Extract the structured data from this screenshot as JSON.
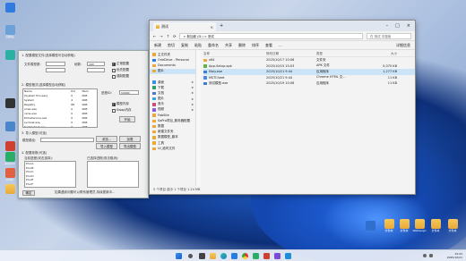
{
  "desktop": {
    "left_icons": [
      {
        "label": "",
        "color": "#2f7be0"
      },
      {
        "label": "回收站",
        "color": "#6aa1d8"
      },
      {
        "label": "",
        "color": "#2ab1a1"
      },
      {
        "label": "",
        "color": "#333333"
      },
      {
        "label": "",
        "color": "#4a86c9"
      },
      {
        "label": "",
        "color": "#d04030"
      },
      {
        "label": "WeChat",
        "color": "#2aae67"
      },
      {
        "label": "Video",
        "color": "#e06040"
      },
      {
        "label": "",
        "color": "#ffb020"
      }
    ],
    "right_icons": [
      {
        "label": ""
      },
      {
        "label": "文件夹"
      },
      {
        "label": "文件夹"
      },
      {
        "label": "WeDesign"
      },
      {
        "label": "文件夹"
      },
      {
        "label": "文件夹"
      }
    ]
  },
  "tool": {
    "sec1": "1. 配置模型文件(选择模型可自动获取)",
    "size_label": "文件模型数:",
    "size_value": "",
    "num_label": "帧数:",
    "num_value": "100",
    "chk1": "正常配置",
    "chk2": "优先配置",
    "chk3": "强制配置",
    "sec2": "2. 模型格式(选择模型自动获取)",
    "table_headers": [
      "Name",
      "Pid",
      "Mem"
    ],
    "table_rows": [
      [
        "[System Process]",
        "0",
        "0KB"
      ],
      [
        "System",
        "4",
        "0KB"
      ],
      [
        "Registry",
        "88",
        "0KB"
      ],
      [
        "smss.exe",
        "0",
        "0KB"
      ],
      [
        "csrss.exe",
        "0",
        "0KB"
      ],
      [
        "ExtraService.exe",
        "0",
        "0KB"
      ],
      [
        "svchost.exe",
        "0",
        "0KB"
      ],
      [
        "fontdrvhost.exe",
        "0",
        "0KB"
      ]
    ],
    "sec2_input_label": "进程ID:",
    "sec2_input_value": "10000",
    "radio1": "模型内存",
    "radio2": "Swap内存",
    "start_btn": "开始",
    "sec3": "3. 导入模型(可选)",
    "model_path_label": "模型路径:",
    "model_path_value": "",
    "btn_browse": "浏览...",
    "btn_load": "加载",
    "btn_import": "导入模型",
    "btn_export": "导出模型",
    "sec4": "4. 配置参数(可选)",
    "left_box_title": "当前进程(双击选择):",
    "left_box_items": [
      "ProcA",
      "ProcB",
      "ProcC",
      "ProcD",
      "ProcE",
      "ProcF"
    ],
    "right_box_title": "已选择进程(双击取消):",
    "footer": "如果遇到问题可以联系管理员,持续更新中...",
    "bottom_btn1": "确定",
    "bottom_btn2": "取消"
  },
  "explorer": {
    "tab": "测试",
    "address": "> 新加卷 (D:) > 测试",
    "search": "在 测试 中搜索",
    "cmd": [
      "新建",
      "剪切",
      "复制",
      "粘贴",
      "重命名",
      "共享",
      "删除",
      "排序",
      "查看",
      "..."
    ],
    "cmd_right": "详细信息",
    "nav": [
      {
        "label": "主文件夹",
        "color": "#e8a93a"
      },
      {
        "label": "OneDrive - Personal",
        "color": "#2f7be0"
      },
      {
        "label": "Documents",
        "color": "#e8a93a"
      },
      {
        "label": "图片",
        "color": "#e8a93a"
      },
      {
        "label": "",
        "color": ""
      },
      {
        "label": "桌面",
        "color": "#3a8fe0"
      },
      {
        "label": "下载",
        "color": "#2aa36a"
      },
      {
        "label": "文档",
        "color": "#4a78c8"
      },
      {
        "label": "图片",
        "color": "#3aa0e0"
      },
      {
        "label": "音乐",
        "color": "#d04d7a"
      },
      {
        "label": "视频",
        "color": "#8a5ad8"
      },
      {
        "label": "FabSite",
        "color": "#e8a93a"
      },
      {
        "label": "SaPro项目_服务器配置",
        "color": "#e8a93a"
      },
      {
        "label": "数据",
        "color": "#e8a93a"
      },
      {
        "label": "新建文件夹",
        "color": "#e8a93a"
      },
      {
        "label": "数据模型_副本",
        "color": "#e8a93a"
      },
      {
        "label": "工具",
        "color": "#e8a93a"
      },
      {
        "label": "UI_临时文件",
        "color": "#e8a93a"
      }
    ],
    "headers": [
      "名称",
      "修改日期",
      "类型",
      "大小"
    ],
    "files": [
      {
        "name": "x64",
        "date": "2025/10/17 10:08",
        "type": "文件夹",
        "size": "",
        "color": "#e8a93a"
      },
      {
        "name": "App-Setup.apk",
        "date": "2025/10/15 15:03",
        "type": "APK 文件",
        "size": "5,075 KB",
        "color": "#5fb14a"
      },
      {
        "name": "Moly.exe",
        "date": "2025/10/21 9:44",
        "type": "应用程序",
        "size": "1,277 KB",
        "color": "#3a7bd5"
      },
      {
        "name": "MSTCheet",
        "date": "2025/10/21 9:44",
        "type": "Chrome HTML 文...",
        "size": "11 KB",
        "color": "#4a86e8"
      },
      {
        "name": "测试模型.exe",
        "date": "2025/10/19 10:08",
        "type": "应用程序",
        "size": "11 KB",
        "color": "#3a7bd5"
      }
    ],
    "selected_index": 2,
    "status": "5 个项目    选中 1 个项目 1.24 MB"
  },
  "taskbar": {
    "weather": "",
    "search": "搜索",
    "time": "19:22",
    "date": "2025/10/21"
  }
}
